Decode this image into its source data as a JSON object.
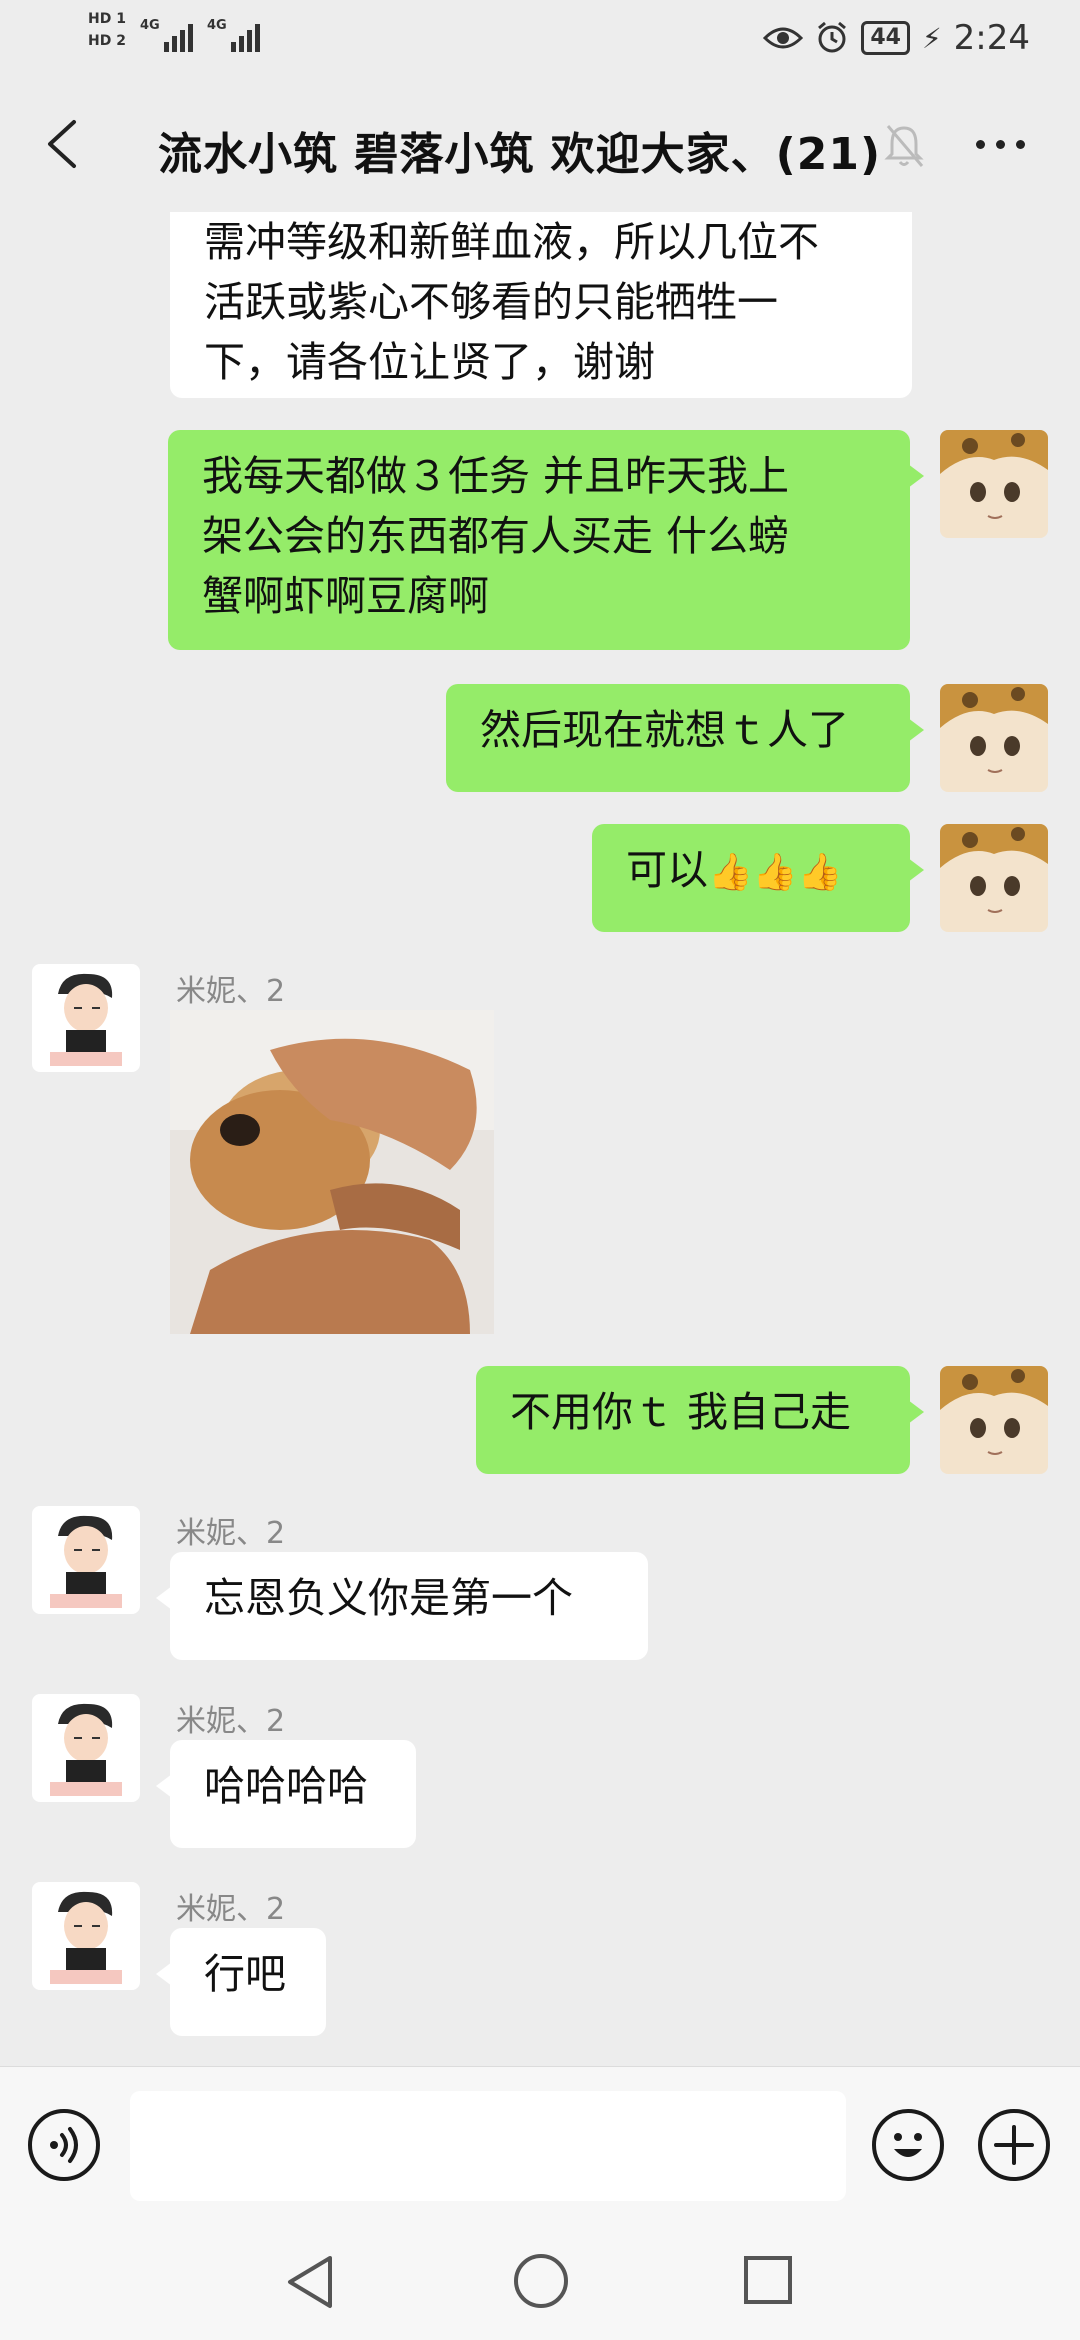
{
  "status_bar": {
    "sim1": "HD 1",
    "sim2": "HD 2",
    "net1": "4G",
    "net2": "4G",
    "battery": "44",
    "time": "2:24"
  },
  "header": {
    "title": "流水小筑 碧落小筑 欢迎大家、(21)"
  },
  "messages": [
    {
      "side": "left",
      "text_lines": [
        "需冲等级和新鲜血液，所以几位不",
        "活跃或紫心不够看的只能牺牲一",
        "下，请各位让贤了，谢谢"
      ]
    },
    {
      "side": "right",
      "text_lines": [
        "我每天都做３任务  并且昨天我上",
        "架公会的东西都有人买走  什么螃",
        "蟹啊虾啊豆腐啊"
      ]
    },
    {
      "side": "right",
      "text": "然后现在就想ｔ人了"
    },
    {
      "side": "right",
      "text": "可以",
      "emoji": "👍👍👍"
    },
    {
      "side": "left",
      "sender": "米妮、2",
      "type": "image",
      "image_desc": "dog-being-petted"
    },
    {
      "side": "right",
      "text": "不用你ｔ  我自己走"
    },
    {
      "side": "left",
      "sender": "米妮、2",
      "text": "忘恩负义你是第一个"
    },
    {
      "side": "left",
      "sender": "米妮、2",
      "text": "哈哈哈哈"
    },
    {
      "side": "left",
      "sender": "米妮、2",
      "text": "行吧"
    }
  ],
  "input": {
    "value": ""
  },
  "colors": {
    "bg": "#ededed",
    "green_bubble": "#95ec69",
    "white_bubble": "#ffffff"
  }
}
